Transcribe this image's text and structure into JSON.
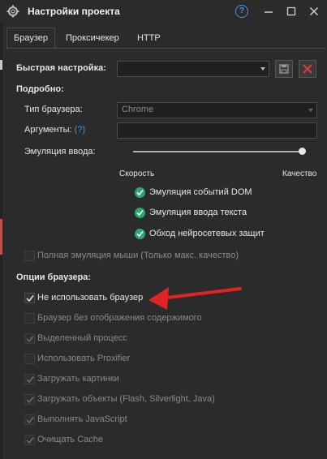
{
  "window": {
    "title": "Настройки проекта"
  },
  "tabs": [
    "Браузер",
    "Проксичекер",
    "HTTP"
  ],
  "quick": {
    "label": "Быстрая настройка:"
  },
  "details": {
    "heading": "Подробно:",
    "browser_type_label": "Тип браузера:",
    "browser_type_value": "Chrome",
    "args_label": "Аргументы:",
    "args_help": "(?)",
    "emulation_label": "Эмуляция ввода:",
    "speed_label": "Скорость",
    "quality_label": "Качество",
    "slider_level": 1.0
  },
  "features": [
    "Эмуляция событий DOM",
    "Эмуляция ввода текста",
    "Обход нейросетевых защит"
  ],
  "mouse_emulation": "Полная эмуляция мыши (Только макс. качество)",
  "options": {
    "heading": "Опции браузера:",
    "items": [
      "Не использовать браузер",
      "Браузер без отображения содержимого",
      "Выделенный процесс",
      "Использовать Proxifier",
      "Загружать картинки",
      "Загружать объекты (Flash, Silverlight, Java)",
      "Выполнять JavaScript",
      "Очищать Cache"
    ]
  },
  "colors": {
    "accent_green": "#2ea66f",
    "arrow_red": "#e02424",
    "help_blue": "#4a90e2",
    "delete_red": "#e03c3c"
  }
}
